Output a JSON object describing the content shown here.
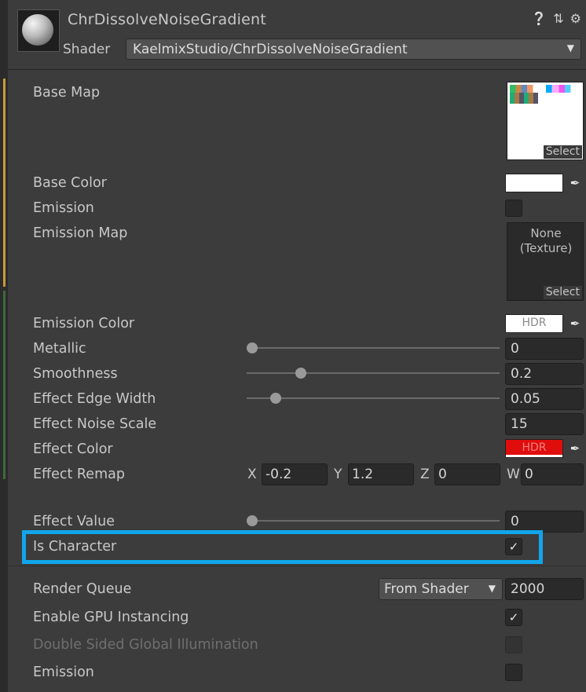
{
  "header": {
    "title": "ChrDissolveNoiseGradient",
    "icons": [
      "help-icon",
      "preset-icon",
      "settings-icon"
    ],
    "shader_label": "Shader",
    "shader_value": "KaelmixStudio/ChrDissolveNoiseGradient"
  },
  "properties": {
    "base_map": {
      "label": "Base Map",
      "select": "Select"
    },
    "base_color": {
      "label": "Base Color",
      "color": "#ffffff"
    },
    "emission": {
      "label": "Emission",
      "checked": false
    },
    "emission_map": {
      "label": "Emission Map",
      "none_line1": "None",
      "none_line2": "(Texture)",
      "select": "Select"
    },
    "emission_color": {
      "label": "Emission Color",
      "hdr": "HDR",
      "color": "#ffffff"
    },
    "metallic": {
      "label": "Metallic",
      "value": "0",
      "slider_fraction": 0
    },
    "smoothness": {
      "label": "Smoothness",
      "value": "0.2",
      "slider_fraction": 0.2
    },
    "effect_edge_width": {
      "label": "Effect Edge Width",
      "value": "0.05",
      "slider_fraction": 0.12
    },
    "effect_noise_scale": {
      "label": "Effect Noise Scale",
      "value": "15"
    },
    "effect_color": {
      "label": "Effect Color",
      "hdr": "HDR",
      "color": "#e00d0d"
    },
    "effect_remap": {
      "label": "Effect Remap",
      "x_label": "X",
      "x_value": "-0.2",
      "y_label": "Y",
      "y_value": "1.2",
      "z_label": "Z",
      "z_value": "0",
      "w_label": "W",
      "w_value": "0"
    },
    "effect_value": {
      "label": "Effect Value",
      "value": "0",
      "slider_fraction": 0
    },
    "is_character": {
      "label": "Is Character",
      "checked": true
    }
  },
  "advanced": {
    "render_queue": {
      "label": "Render Queue",
      "dropdown": "From Shader",
      "value": "2000"
    },
    "gpu_instancing": {
      "label": "Enable GPU Instancing",
      "checked": true
    },
    "double_sided_gi": {
      "label": "Double Sided Global Illumination",
      "checked": false,
      "disabled": true
    },
    "emission": {
      "label": "Emission",
      "checked": false
    }
  },
  "colors": {
    "highlight": "#12a5ec",
    "panel_bg": "#3c3c3c",
    "field_bg": "#2a2a2a"
  }
}
